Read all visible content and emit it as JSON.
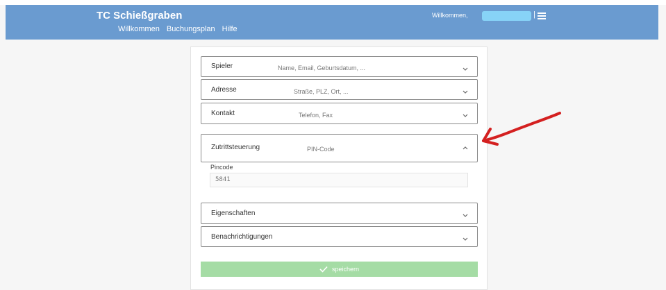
{
  "header": {
    "brand": "TC Schießgraben",
    "nav": [
      "Willkommen",
      "Buchungsplan",
      "Hilfe"
    ],
    "welcome": "Willkommen,",
    "separator": "|",
    "menu_icon": "hamburger-icon",
    "color": "#6a9bd0"
  },
  "sections": [
    {
      "label": "Spieler",
      "hint": "Name, Email, Geburtsdatum, ...",
      "expanded": false
    },
    {
      "label": "Adresse",
      "hint": "Straße, PLZ, Ort, ...",
      "expanded": false
    },
    {
      "label": "Kontakt",
      "hint": "Telefon, Fax",
      "expanded": false
    },
    {
      "label": "Zutrittsteuerung",
      "hint": "PIN-Code",
      "expanded": true
    },
    {
      "label": "Eigenschaften",
      "hint": "",
      "expanded": false
    },
    {
      "label": "Benachrichtigungen",
      "hint": "",
      "expanded": false
    }
  ],
  "pincode": {
    "label": "Pincode",
    "value": "5841"
  },
  "save": {
    "label": "speichern",
    "icon": "check-icon",
    "color": "#a5dca5"
  },
  "annotation": {
    "icon": "red-arrow-icon",
    "color": "#d42020"
  }
}
